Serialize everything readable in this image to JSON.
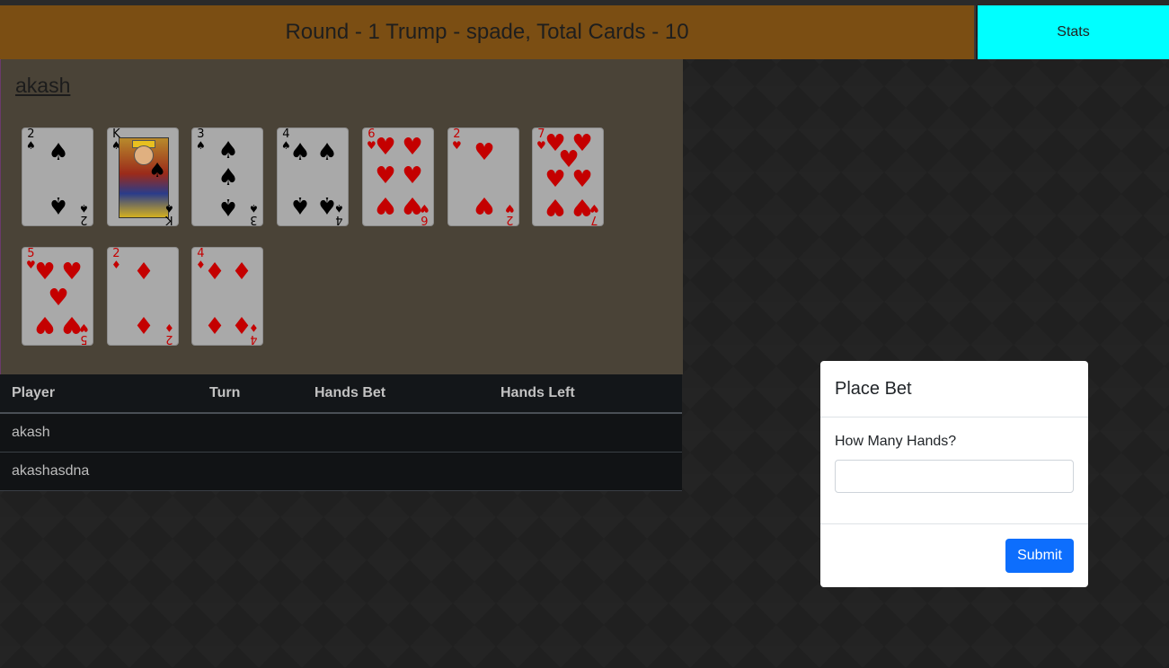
{
  "header": {
    "title": "Round - 1 Trump - spade, Total Cards - 10"
  },
  "stats_button": {
    "label": "Stats",
    "color": "#00ffff"
  },
  "hand": {
    "player_name": "akash",
    "cards": [
      {
        "rank": "2",
        "suit": "spade",
        "symbol": "♠",
        "color": "black"
      },
      {
        "rank": "K",
        "suit": "spade",
        "symbol": "♠",
        "color": "black"
      },
      {
        "rank": "3",
        "suit": "spade",
        "symbol": "♠",
        "color": "black"
      },
      {
        "rank": "4",
        "suit": "spade",
        "symbol": "♠",
        "color": "black"
      },
      {
        "rank": "6",
        "suit": "heart",
        "symbol": "♥",
        "color": "red"
      },
      {
        "rank": "2",
        "suit": "heart",
        "symbol": "♥",
        "color": "red"
      },
      {
        "rank": "7",
        "suit": "heart",
        "symbol": "♥",
        "color": "red"
      },
      {
        "rank": "5",
        "suit": "heart",
        "symbol": "♥",
        "color": "red"
      },
      {
        "rank": "2",
        "suit": "diamond",
        "symbol": "♦",
        "color": "red"
      },
      {
        "rank": "4",
        "suit": "diamond",
        "symbol": "♦",
        "color": "red"
      }
    ]
  },
  "players_table": {
    "headers": [
      "Player",
      "Turn",
      "Hands Bet",
      "Hands Left"
    ],
    "rows": [
      [
        "akash",
        "",
        "",
        ""
      ],
      [
        "akashasdna",
        "",
        "",
        ""
      ]
    ]
  },
  "bet_modal": {
    "title": "Place Bet",
    "label": "How Many Hands?",
    "input_value": "",
    "submit_label": "Submit"
  }
}
